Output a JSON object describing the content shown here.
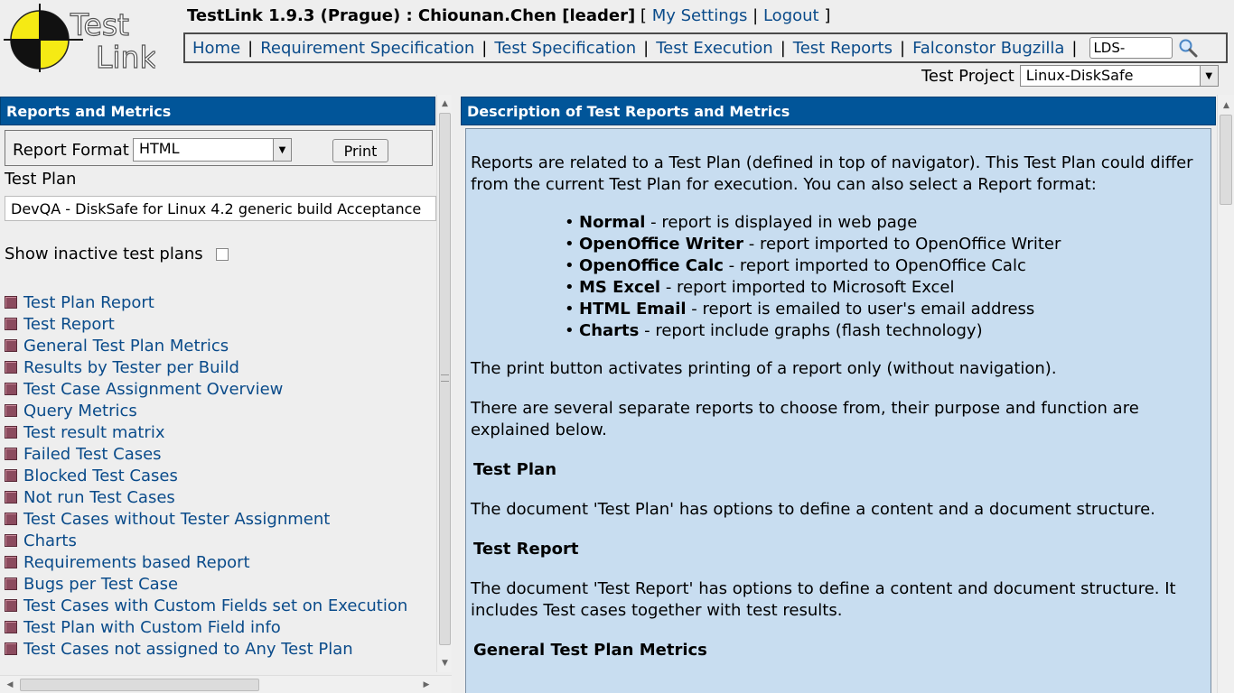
{
  "header": {
    "app_title": "TestLink 1.9.3 (Prague) : Chiounan.Chen [leader]",
    "bracket_open": "[",
    "my_settings": "My Settings",
    "pipe": "|",
    "logout": "Logout",
    "bracket_close": "]",
    "nav": [
      "Home",
      "Requirement Specification",
      "Test Specification",
      "Test Execution",
      "Test Reports",
      "Falconstor Bugzilla"
    ],
    "search_value": "LDS-",
    "project_label": "Test Project",
    "project_value": "Linux-DiskSafe",
    "logo_text_1": "Test",
    "logo_text_2": "Link"
  },
  "left": {
    "title": "Reports and Metrics",
    "format_label": "Report Format",
    "format_value": "HTML",
    "print_label": "Print",
    "test_plan_label": "Test Plan",
    "test_plan_value": "DevQA - DiskSafe for Linux 4.2 generic build Acceptance",
    "show_inactive_label": "Show inactive test plans",
    "reports": [
      "Test Plan Report",
      "Test Report",
      "General Test Plan Metrics",
      "Results by Tester per Build",
      "Test Case Assignment Overview",
      "Query Metrics",
      "Test result matrix",
      "Failed Test Cases",
      "Blocked Test Cases",
      "Not run Test Cases",
      "Test Cases without Tester Assignment",
      "Charts",
      "Requirements based Report",
      "Bugs per Test Case",
      "Test Cases with Custom Fields set on Execution",
      "Test Plan with Custom Field info",
      "Test Cases not assigned to Any Test Plan"
    ]
  },
  "right": {
    "title": "Description of Test Reports and Metrics",
    "intro": "Reports are related to a Test Plan (defined in top of navigator). This Test Plan could differ from the current Test Plan for execution. You can also select a Report format:",
    "formats": [
      {
        "name": "Normal",
        "desc": " - report is displayed in web page"
      },
      {
        "name": "OpenOffice Writer",
        "desc": " - report imported to OpenOffice Writer"
      },
      {
        "name": "OpenOffice Calc",
        "desc": " - report imported to OpenOffice Calc"
      },
      {
        "name": "MS Excel",
        "desc": " - report imported to Microsoft Excel"
      },
      {
        "name": "HTML Email",
        "desc": " - report is emailed to user's email address"
      },
      {
        "name": "Charts",
        "desc": " - report include graphs (flash technology)"
      }
    ],
    "print_note": "The print button activates printing of a report only (without navigation).",
    "several_note": "There are several separate reports to choose from, their purpose and function are explained below.",
    "sections": [
      {
        "heading": "Test Plan",
        "text": "The document 'Test Plan' has options to define a content and a document structure."
      },
      {
        "heading": "Test Report",
        "text": "The document 'Test Report' has options to define a content and document structure. It includes Test cases together with test results."
      },
      {
        "heading": "General Test Plan Metrics",
        "text": ""
      }
    ]
  }
}
